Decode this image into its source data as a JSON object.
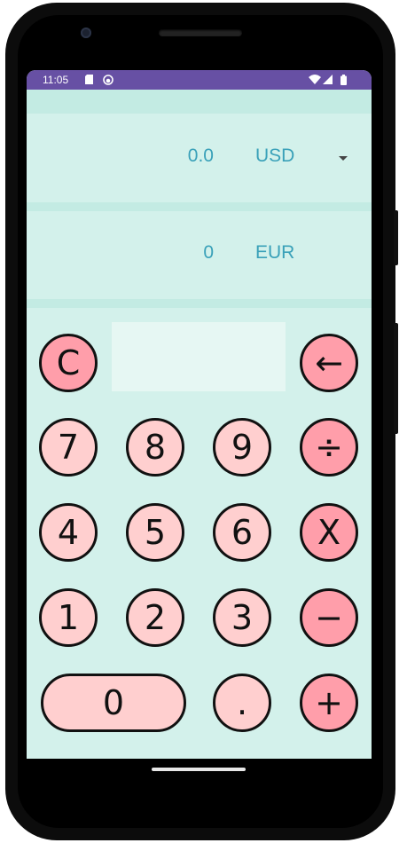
{
  "status_bar": {
    "time": "11:05",
    "icons": [
      "sd-card-icon",
      "circle-face-icon"
    ],
    "right_icons": [
      "wifi-icon",
      "signal-icon",
      "battery-icon"
    ]
  },
  "conversion": {
    "from": {
      "value": "0.0",
      "currency": "USD"
    },
    "to": {
      "value": "0",
      "currency": "EUR"
    }
  },
  "keypad": {
    "clear": "C",
    "backspace": "←",
    "divide": "÷",
    "multiply": "X",
    "subtract": "−",
    "add": "+",
    "decimal": ".",
    "digits": [
      "0",
      "1",
      "2",
      "3",
      "4",
      "5",
      "6",
      "7",
      "8",
      "9"
    ]
  },
  "colors": {
    "screen_bg": "#d3f1eb",
    "band": "#c3ebe3",
    "status_bar": "#6750a4",
    "accent_text": "#3aa1b9",
    "digit_key": "#ffcfcf",
    "operator_key": "#ff9eaa"
  }
}
